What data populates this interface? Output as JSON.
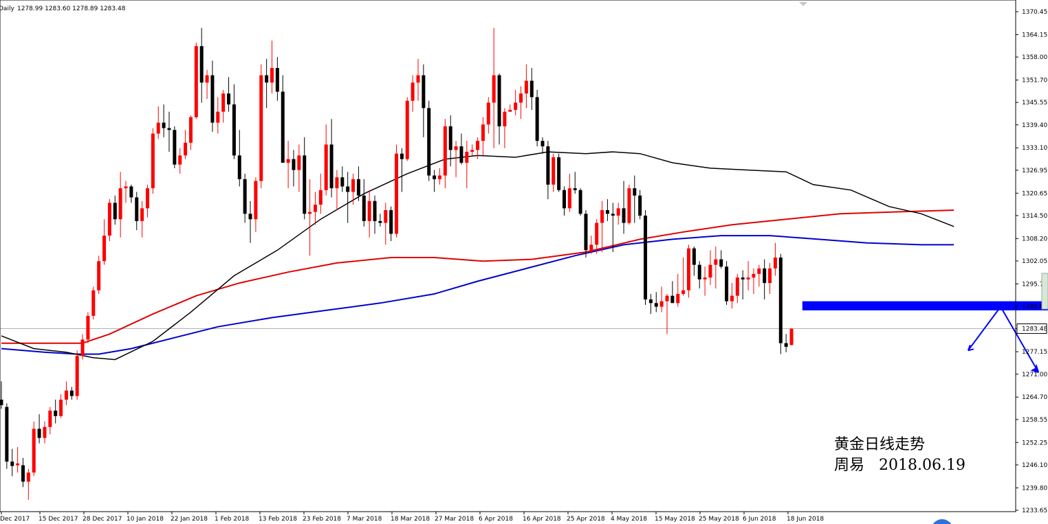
{
  "header": {
    "timeframe": "Daily",
    "ohlc": "1278.99 1283.60 1278.89 1283.48"
  },
  "annotation": {
    "title": "黄金日线走势",
    "author_date": "周易   2018.06.19"
  },
  "colors": {
    "bull": "#ff0000",
    "bear": "#000000",
    "ma_fast": "#000000",
    "ma_mid": "#e00000",
    "ma_slow": "#0000cc",
    "zone": "#0000ff",
    "arrow": "#0000ff",
    "price_line": "#b0b0b0",
    "current_price_bg": "#ffffff"
  },
  "chart_data": {
    "type": "candlestick",
    "title": "",
    "ylim": [
      1233.65,
      1373.0
    ],
    "y_ticks": [
      "1370.45",
      "1364.15",
      "1358.00",
      "1351.70",
      "1345.55",
      "1339.40",
      "1333.10",
      "1326.95",
      "1320.65",
      "1314.50",
      "1308.20",
      "1302.05",
      "1295.75",
      "1289.60",
      "1283.48",
      "1277.15",
      "1271.00",
      "1264.70",
      "1258.55",
      "1252.25",
      "1246.10",
      "1239.80",
      "1233.65"
    ],
    "x_ticks": [
      "Dec 2017",
      "15 Dec 2017",
      "28 Dec 2017",
      "10 Jan 2018",
      "22 Jan 2018",
      "1 Feb 2018",
      "13 Feb 2018",
      "23 Feb 2018",
      "7 Mar 2018",
      "18 Mar 2018",
      "27 Mar 2018",
      "6 Apr 2018",
      "16 Apr 2018",
      "25 Apr 2018",
      "4 May 2018",
      "15 May 2018",
      "25 May 2018",
      "6 Jun 2018",
      "18 Jun 2018"
    ],
    "current_price": 1283.48,
    "candles": [
      {
        "o": 1264.0,
        "h": 1269.0,
        "l": 1261.5,
        "c": 1262.5
      },
      {
        "o": 1262.0,
        "h": 1263.0,
        "l": 1245.0,
        "c": 1247.0
      },
      {
        "o": 1247.0,
        "h": 1250.5,
        "l": 1243.0,
        "c": 1245.8
      },
      {
        "o": 1246.0,
        "h": 1251.0,
        "l": 1244.0,
        "c": 1246.5
      },
      {
        "o": 1246.0,
        "h": 1248.0,
        "l": 1240.0,
        "c": 1241.5
      },
      {
        "o": 1241.5,
        "h": 1245.0,
        "l": 1236.5,
        "c": 1244.0
      },
      {
        "o": 1244.0,
        "h": 1258.0,
        "l": 1243.0,
        "c": 1256.0
      },
      {
        "o": 1256.0,
        "h": 1260.0,
        "l": 1252.0,
        "c": 1253.5
      },
      {
        "o": 1253.5,
        "h": 1258.0,
        "l": 1252.0,
        "c": 1256.5
      },
      {
        "o": 1256.5,
        "h": 1262.0,
        "l": 1254.5,
        "c": 1261.0
      },
      {
        "o": 1261.0,
        "h": 1264.0,
        "l": 1257.5,
        "c": 1259.5
      },
      {
        "o": 1259.5,
        "h": 1265.5,
        "l": 1259.0,
        "c": 1264.0
      },
      {
        "o": 1264.0,
        "h": 1269.0,
        "l": 1262.5,
        "c": 1266.5
      },
      {
        "o": 1266.5,
        "h": 1267.5,
        "l": 1264.0,
        "c": 1265.0
      },
      {
        "o": 1265.0,
        "h": 1277.5,
        "l": 1264.0,
        "c": 1276.0
      },
      {
        "o": 1276.0,
        "h": 1282.0,
        "l": 1275.0,
        "c": 1280.5
      },
      {
        "o": 1280.5,
        "h": 1288.0,
        "l": 1279.5,
        "c": 1287.0
      },
      {
        "o": 1287.0,
        "h": 1295.0,
        "l": 1286.0,
        "c": 1294.0
      },
      {
        "o": 1294.0,
        "h": 1303.5,
        "l": 1293.0,
        "c": 1302.0
      },
      {
        "o": 1302.0,
        "h": 1313.5,
        "l": 1301.0,
        "c": 1309.0
      },
      {
        "o": 1309.0,
        "h": 1319.0,
        "l": 1307.5,
        "c": 1318.0
      },
      {
        "o": 1318.0,
        "h": 1320.0,
        "l": 1312.0,
        "c": 1313.5
      },
      {
        "o": 1313.5,
        "h": 1326.5,
        "l": 1308.5,
        "c": 1322.0
      },
      {
        "o": 1322.0,
        "h": 1324.0,
        "l": 1318.0,
        "c": 1322.5
      },
      {
        "o": 1322.5,
        "h": 1323.0,
        "l": 1318.0,
        "c": 1319.5
      },
      {
        "o": 1319.5,
        "h": 1321.0,
        "l": 1310.5,
        "c": 1313.0
      },
      {
        "o": 1313.0,
        "h": 1318.5,
        "l": 1308.5,
        "c": 1316.5
      },
      {
        "o": 1316.5,
        "h": 1323.0,
        "l": 1314.0,
        "c": 1322.0
      },
      {
        "o": 1322.0,
        "h": 1338.5,
        "l": 1320.5,
        "c": 1337.0
      },
      {
        "o": 1337.0,
        "h": 1344.5,
        "l": 1335.5,
        "c": 1340.0
      },
      {
        "o": 1340.0,
        "h": 1345.0,
        "l": 1336.0,
        "c": 1338.5
      },
      {
        "o": 1338.5,
        "h": 1343.0,
        "l": 1332.0,
        "c": 1338.0
      },
      {
        "o": 1338.0,
        "h": 1339.0,
        "l": 1327.5,
        "c": 1328.5
      },
      {
        "o": 1328.5,
        "h": 1333.0,
        "l": 1326.0,
        "c": 1331.0
      },
      {
        "o": 1331.0,
        "h": 1338.0,
        "l": 1330.0,
        "c": 1334.5
      },
      {
        "o": 1334.5,
        "h": 1342.0,
        "l": 1332.5,
        "c": 1341.5
      },
      {
        "o": 1341.5,
        "h": 1362.0,
        "l": 1341.0,
        "c": 1361.0
      },
      {
        "o": 1361.0,
        "h": 1366.0,
        "l": 1345.5,
        "c": 1351.0
      },
      {
        "o": 1351.0,
        "h": 1354.5,
        "l": 1346.5,
        "c": 1353.0
      },
      {
        "o": 1353.0,
        "h": 1357.0,
        "l": 1337.5,
        "c": 1340.0
      },
      {
        "o": 1340.0,
        "h": 1347.0,
        "l": 1337.0,
        "c": 1343.0
      },
      {
        "o": 1343.0,
        "h": 1349.0,
        "l": 1340.0,
        "c": 1348.0
      },
      {
        "o": 1348.0,
        "h": 1352.5,
        "l": 1343.0,
        "c": 1345.0
      },
      {
        "o": 1345.0,
        "h": 1350.5,
        "l": 1330.0,
        "c": 1331.0
      },
      {
        "o": 1331.0,
        "h": 1338.0,
        "l": 1322.5,
        "c": 1324.5
      },
      {
        "o": 1324.5,
        "h": 1326.0,
        "l": 1312.5,
        "c": 1315.0
      },
      {
        "o": 1315.0,
        "h": 1318.5,
        "l": 1307.0,
        "c": 1313.5
      },
      {
        "o": 1313.5,
        "h": 1325.0,
        "l": 1310.0,
        "c": 1324.0
      },
      {
        "o": 1324.0,
        "h": 1356.0,
        "l": 1322.0,
        "c": 1353.0
      },
      {
        "o": 1353.0,
        "h": 1357.5,
        "l": 1344.0,
        "c": 1351.0
      },
      {
        "o": 1351.0,
        "h": 1362.5,
        "l": 1348.0,
        "c": 1355.0
      },
      {
        "o": 1355.0,
        "h": 1358.0,
        "l": 1346.0,
        "c": 1348.5
      },
      {
        "o": 1348.5,
        "h": 1353.0,
        "l": 1337.0,
        "c": 1329.0
      },
      {
        "o": 1329.0,
        "h": 1335.0,
        "l": 1322.0,
        "c": 1330.0
      },
      {
        "o": 1330.0,
        "h": 1332.5,
        "l": 1322.5,
        "c": 1327.0
      },
      {
        "o": 1327.0,
        "h": 1334.0,
        "l": 1321.0,
        "c": 1331.0
      },
      {
        "o": 1331.0,
        "h": 1336.0,
        "l": 1313.5,
        "c": 1315.0
      },
      {
        "o": 1315.0,
        "h": 1324.5,
        "l": 1303.5,
        "c": 1315.5
      },
      {
        "o": 1315.5,
        "h": 1321.0,
        "l": 1312.0,
        "c": 1317.5
      },
      {
        "o": 1317.5,
        "h": 1326.0,
        "l": 1315.0,
        "c": 1321.5
      },
      {
        "o": 1321.5,
        "h": 1339.5,
        "l": 1320.0,
        "c": 1334.0
      },
      {
        "o": 1334.0,
        "h": 1341.0,
        "l": 1319.5,
        "c": 1322.0
      },
      {
        "o": 1322.0,
        "h": 1327.0,
        "l": 1316.0,
        "c": 1325.0
      },
      {
        "o": 1325.0,
        "h": 1328.0,
        "l": 1321.0,
        "c": 1322.5
      },
      {
        "o": 1322.5,
        "h": 1326.5,
        "l": 1312.5,
        "c": 1321.0
      },
      {
        "o": 1321.0,
        "h": 1326.0,
        "l": 1317.5,
        "c": 1324.5
      },
      {
        "o": 1324.5,
        "h": 1328.0,
        "l": 1318.5,
        "c": 1320.0
      },
      {
        "o": 1320.0,
        "h": 1324.5,
        "l": 1311.5,
        "c": 1313.0
      },
      {
        "o": 1313.0,
        "h": 1321.5,
        "l": 1308.5,
        "c": 1318.5
      },
      {
        "o": 1318.5,
        "h": 1320.0,
        "l": 1309.5,
        "c": 1313.0
      },
      {
        "o": 1313.0,
        "h": 1315.0,
        "l": 1311.5,
        "c": 1312.5
      },
      {
        "o": 1312.5,
        "h": 1318.0,
        "l": 1306.5,
        "c": 1316.0
      },
      {
        "o": 1316.0,
        "h": 1317.0,
        "l": 1307.5,
        "c": 1309.5
      },
      {
        "o": 1309.5,
        "h": 1334.0,
        "l": 1308.5,
        "c": 1331.5
      },
      {
        "o": 1331.5,
        "h": 1333.0,
        "l": 1321.0,
        "c": 1330.0
      },
      {
        "o": 1330.0,
        "h": 1347.0,
        "l": 1329.5,
        "c": 1346.0
      },
      {
        "o": 1346.0,
        "h": 1353.0,
        "l": 1343.0,
        "c": 1351.0
      },
      {
        "o": 1351.0,
        "h": 1357.5,
        "l": 1346.0,
        "c": 1353.0
      },
      {
        "o": 1353.0,
        "h": 1356.0,
        "l": 1336.0,
        "c": 1344.0
      },
      {
        "o": 1344.0,
        "h": 1346.0,
        "l": 1324.0,
        "c": 1325.5
      },
      {
        "o": 1325.5,
        "h": 1327.0,
        "l": 1321.0,
        "c": 1324.5
      },
      {
        "o": 1324.5,
        "h": 1327.5,
        "l": 1323.0,
        "c": 1325.5
      },
      {
        "o": 1325.5,
        "h": 1341.0,
        "l": 1322.0,
        "c": 1339.0
      },
      {
        "o": 1339.0,
        "h": 1342.0,
        "l": 1328.0,
        "c": 1332.5
      },
      {
        "o": 1332.5,
        "h": 1335.0,
        "l": 1325.0,
        "c": 1333.5
      },
      {
        "o": 1333.5,
        "h": 1337.0,
        "l": 1328.5,
        "c": 1329.0
      },
      {
        "o": 1329.0,
        "h": 1335.0,
        "l": 1322.0,
        "c": 1332.0
      },
      {
        "o": 1332.0,
        "h": 1334.0,
        "l": 1331.0,
        "c": 1332.5
      },
      {
        "o": 1332.5,
        "h": 1336.0,
        "l": 1330.0,
        "c": 1335.0
      },
      {
        "o": 1335.0,
        "h": 1341.5,
        "l": 1331.0,
        "c": 1339.5
      },
      {
        "o": 1339.5,
        "h": 1347.0,
        "l": 1337.0,
        "c": 1345.5
      },
      {
        "o": 1345.5,
        "h": 1366.0,
        "l": 1333.0,
        "c": 1353.0
      },
      {
        "o": 1353.0,
        "h": 1353.5,
        "l": 1334.0,
        "c": 1339.0
      },
      {
        "o": 1339.0,
        "h": 1344.0,
        "l": 1333.0,
        "c": 1343.0
      },
      {
        "o": 1343.0,
        "h": 1345.0,
        "l": 1343.0,
        "c": 1343.5
      },
      {
        "o": 1343.5,
        "h": 1349.0,
        "l": 1342.0,
        "c": 1345.5
      },
      {
        "o": 1345.5,
        "h": 1350.0,
        "l": 1341.0,
        "c": 1348.0
      },
      {
        "o": 1348.0,
        "h": 1356.0,
        "l": 1344.0,
        "c": 1351.5
      },
      {
        "o": 1351.5,
        "h": 1355.0,
        "l": 1343.5,
        "c": 1347.0
      },
      {
        "o": 1347.0,
        "h": 1349.0,
        "l": 1333.5,
        "c": 1335.0
      },
      {
        "o": 1335.0,
        "h": 1336.0,
        "l": 1331.5,
        "c": 1333.5
      },
      {
        "o": 1333.5,
        "h": 1335.0,
        "l": 1319.0,
        "c": 1323.0
      },
      {
        "o": 1323.0,
        "h": 1331.5,
        "l": 1321.0,
        "c": 1330.5
      },
      {
        "o": 1330.5,
        "h": 1331.5,
        "l": 1321.0,
        "c": 1321.5
      },
      {
        "o": 1321.5,
        "h": 1322.5,
        "l": 1314.5,
        "c": 1316.5
      },
      {
        "o": 1316.5,
        "h": 1326.0,
        "l": 1315.5,
        "c": 1322.0
      },
      {
        "o": 1322.0,
        "h": 1326.5,
        "l": 1320.5,
        "c": 1321.5
      },
      {
        "o": 1321.5,
        "h": 1322.0,
        "l": 1314.5,
        "c": 1315.0
      },
      {
        "o": 1315.0,
        "h": 1316.0,
        "l": 1303.0,
        "c": 1305.0
      },
      {
        "o": 1305.0,
        "h": 1309.0,
        "l": 1304.0,
        "c": 1306.5
      },
      {
        "o": 1306.5,
        "h": 1313.5,
        "l": 1304.0,
        "c": 1312.5
      },
      {
        "o": 1312.5,
        "h": 1318.5,
        "l": 1304.5,
        "c": 1316.0
      },
      {
        "o": 1316.0,
        "h": 1319.0,
        "l": 1313.0,
        "c": 1315.0
      },
      {
        "o": 1315.0,
        "h": 1318.0,
        "l": 1304.5,
        "c": 1314.5
      },
      {
        "o": 1314.5,
        "h": 1318.0,
        "l": 1312.0,
        "c": 1316.5
      },
      {
        "o": 1316.5,
        "h": 1324.0,
        "l": 1309.5,
        "c": 1312.5
      },
      {
        "o": 1312.5,
        "h": 1323.0,
        "l": 1312.0,
        "c": 1322.0
      },
      {
        "o": 1322.0,
        "h": 1325.5,
        "l": 1312.5,
        "c": 1320.0
      },
      {
        "o": 1320.0,
        "h": 1321.5,
        "l": 1313.5,
        "c": 1314.5
      },
      {
        "o": 1314.5,
        "h": 1316.0,
        "l": 1290.0,
        "c": 1291.5
      },
      {
        "o": 1291.5,
        "h": 1293.0,
        "l": 1287.5,
        "c": 1290.5
      },
      {
        "o": 1290.5,
        "h": 1293.5,
        "l": 1288.0,
        "c": 1289.5
      },
      {
        "o": 1289.5,
        "h": 1295.0,
        "l": 1288.0,
        "c": 1291.0
      },
      {
        "o": 1291.0,
        "h": 1293.0,
        "l": 1282.0,
        "c": 1292.5
      },
      {
        "o": 1292.5,
        "h": 1296.5,
        "l": 1291.0,
        "c": 1290.5
      },
      {
        "o": 1290.5,
        "h": 1298.5,
        "l": 1289.5,
        "c": 1293.0
      },
      {
        "o": 1293.0,
        "h": 1303.0,
        "l": 1292.5,
        "c": 1294.0
      },
      {
        "o": 1294.0,
        "h": 1306.5,
        "l": 1292.0,
        "c": 1305.5
      },
      {
        "o": 1305.5,
        "h": 1306.0,
        "l": 1298.0,
        "c": 1301.0
      },
      {
        "o": 1301.0,
        "h": 1302.0,
        "l": 1294.5,
        "c": 1297.0
      },
      {
        "o": 1297.0,
        "h": 1300.5,
        "l": 1292.5,
        "c": 1297.5
      },
      {
        "o": 1297.5,
        "h": 1305.0,
        "l": 1295.5,
        "c": 1301.0
      },
      {
        "o": 1301.0,
        "h": 1306.0,
        "l": 1294.5,
        "c": 1302.5
      },
      {
        "o": 1302.5,
        "h": 1305.0,
        "l": 1300.0,
        "c": 1300.5
      },
      {
        "o": 1300.5,
        "h": 1302.0,
        "l": 1290.0,
        "c": 1291.0
      },
      {
        "o": 1291.0,
        "h": 1296.0,
        "l": 1289.0,
        "c": 1292.5
      },
      {
        "o": 1292.5,
        "h": 1298.5,
        "l": 1290.5,
        "c": 1297.5
      },
      {
        "o": 1297.5,
        "h": 1299.5,
        "l": 1291.5,
        "c": 1297.0
      },
      {
        "o": 1297.0,
        "h": 1302.0,
        "l": 1294.0,
        "c": 1297.5
      },
      {
        "o": 1297.5,
        "h": 1300.0,
        "l": 1293.0,
        "c": 1298.5
      },
      {
        "o": 1298.5,
        "h": 1301.0,
        "l": 1295.0,
        "c": 1300.0
      },
      {
        "o": 1300.0,
        "h": 1302.5,
        "l": 1291.5,
        "c": 1296.0
      },
      {
        "o": 1296.0,
        "h": 1301.5,
        "l": 1293.0,
        "c": 1300.0
      },
      {
        "o": 1300.0,
        "h": 1307.0,
        "l": 1298.0,
        "c": 1303.0
      },
      {
        "o": 1303.0,
        "h": 1304.0,
        "l": 1276.5,
        "c": 1279.5
      },
      {
        "o": 1279.5,
        "h": 1282.0,
        "l": 1277.0,
        "c": 1278.5
      },
      {
        "o": 1278.99,
        "h": 1283.6,
        "l": 1278.89,
        "c": 1283.48
      }
    ],
    "ma_fast": [
      [
        0,
        1281.5
      ],
      [
        6,
        1278.0
      ],
      [
        12,
        1277.0
      ],
      [
        17,
        1275.5
      ],
      [
        21,
        1275.0
      ],
      [
        28,
        1280.0
      ],
      [
        35,
        1288.0
      ],
      [
        43,
        1298.0
      ],
      [
        51,
        1305.0
      ],
      [
        59,
        1313.5
      ],
      [
        67,
        1320.5
      ],
      [
        75,
        1326.0
      ],
      [
        82,
        1330.0
      ],
      [
        88,
        1331.0
      ],
      [
        95,
        1330.5
      ],
      [
        101,
        1332.0
      ],
      [
        108,
        1331.5
      ],
      [
        113,
        1332.0
      ],
      [
        118,
        1331.5
      ],
      [
        124,
        1329.0
      ],
      [
        131,
        1327.5
      ],
      [
        138,
        1327.0
      ],
      [
        145,
        1326.5
      ],
      [
        150,
        1323.0
      ],
      [
        157,
        1321.5
      ],
      [
        164,
        1317.0
      ],
      [
        170,
        1315.0
      ],
      [
        176,
        1311.5
      ]
    ],
    "ma_mid": [
      [
        0,
        1279.5
      ],
      [
        8,
        1279.5
      ],
      [
        15,
        1279.5
      ],
      [
        20,
        1282.0
      ],
      [
        28,
        1287.5
      ],
      [
        36,
        1292.5
      ],
      [
        44,
        1296.0
      ],
      [
        53,
        1299.0
      ],
      [
        62,
        1301.5
      ],
      [
        72,
        1303.0
      ],
      [
        80,
        1303.0
      ],
      [
        89,
        1302.0
      ],
      [
        98,
        1302.5
      ],
      [
        108,
        1304.5
      ],
      [
        118,
        1308.0
      ],
      [
        126,
        1310.0
      ],
      [
        135,
        1312.0
      ],
      [
        145,
        1313.5
      ],
      [
        155,
        1315.0
      ],
      [
        165,
        1315.5
      ],
      [
        176,
        1316.0
      ]
    ],
    "ma_slow": [
      [
        0,
        1278.0
      ],
      [
        8,
        1277.0
      ],
      [
        14,
        1276.5
      ],
      [
        18,
        1276.5
      ],
      [
        24,
        1278.0
      ],
      [
        32,
        1281.0
      ],
      [
        40,
        1284.0
      ],
      [
        50,
        1286.5
      ],
      [
        60,
        1288.5
      ],
      [
        70,
        1290.5
      ],
      [
        80,
        1293.0
      ],
      [
        88,
        1296.5
      ],
      [
        97,
        1300.0
      ],
      [
        106,
        1303.5
      ],
      [
        115,
        1306.5
      ],
      [
        124,
        1308.0
      ],
      [
        133,
        1309.0
      ],
      [
        142,
        1309.0
      ],
      [
        151,
        1308.0
      ],
      [
        160,
        1307.0
      ],
      [
        170,
        1306.5
      ],
      [
        176,
        1306.5
      ]
    ],
    "zone": {
      "y_top": 1291.0,
      "y_bottom": 1288.5,
      "x_start_index": 148,
      "x_end_index": 196
    },
    "arrow_path": [
      [
        178,
        1277.5
      ],
      [
        184,
        1289.5
      ],
      [
        191,
        1271.5
      ]
    ],
    "grid": false,
    "legend": "none"
  }
}
